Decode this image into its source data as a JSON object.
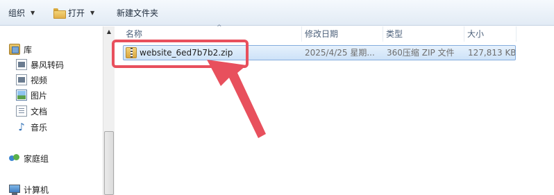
{
  "toolbar": {
    "organize_label": "组织",
    "open_label": "打开",
    "new_folder_label": "新建文件夹"
  },
  "nav": {
    "items": [
      {
        "label": "库",
        "icon": "library-icon"
      },
      {
        "label": "暴风转码",
        "icon": "video-icon"
      },
      {
        "label": "视频",
        "icon": "video-icon"
      },
      {
        "label": "图片",
        "icon": "picture-icon"
      },
      {
        "label": "文档",
        "icon": "document-icon"
      },
      {
        "label": "音乐",
        "icon": "music-icon"
      },
      {
        "label": "家庭组",
        "icon": "homegroup-icon"
      },
      {
        "label": "计算机",
        "icon": "computer-icon"
      }
    ]
  },
  "columns": {
    "name": "名称",
    "modified": "修改日期",
    "type": "类型",
    "size": "大小"
  },
  "files": [
    {
      "name": "website_6ed7b7b2.zip",
      "modified": "2025/4/25 星期...",
      "type": "360压缩 ZIP 文件",
      "size": "127,813 KB",
      "icon": "zip-archive-icon"
    }
  ],
  "colors": {
    "annotation": "#e8505d",
    "selection": "#cde2f8"
  }
}
